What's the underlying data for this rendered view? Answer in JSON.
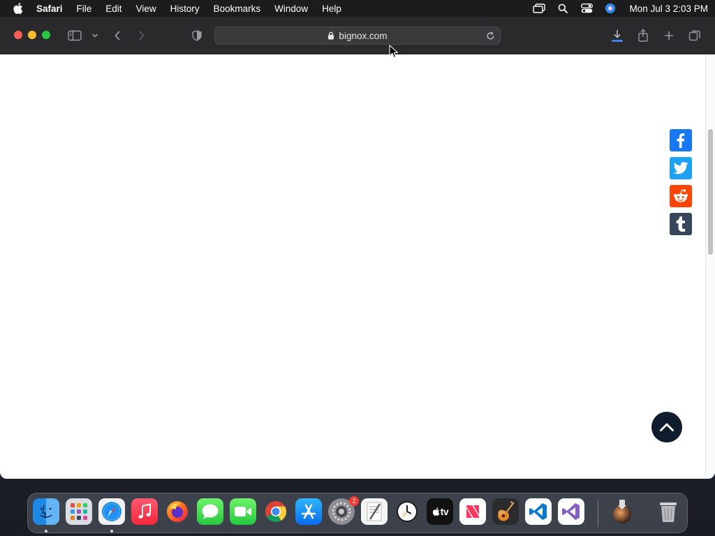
{
  "menubar": {
    "app_name": "Safari",
    "menus": [
      "File",
      "Edit",
      "View",
      "History",
      "Bookmarks",
      "Window",
      "Help"
    ],
    "clock": "Mon Jul 3  2:03 PM"
  },
  "toolbar": {
    "url": "bignox.com"
  },
  "page": {
    "share_buttons": [
      "facebook",
      "twitter",
      "reddit",
      "tumblr"
    ],
    "scroll_position": 0.12
  },
  "dock": {
    "apps": [
      "Finder",
      "Launchpad",
      "Safari",
      "Music",
      "Firefox",
      "Messages",
      "FaceTime",
      "Chrome",
      "App Store",
      "System Settings",
      "TextEdit",
      "Clock",
      "TV",
      "News",
      "GarageBand",
      "VS Code",
      "Visual Studio",
      "Downloads",
      "Trash"
    ],
    "tv_label": "tv",
    "settings_badge": "2"
  },
  "colors": {
    "facebook": "#1877f2",
    "twitter": "#1da1f2",
    "reddit": "#ff4500",
    "tumblr": "#36465d",
    "back_to_top": "#0f1c2e"
  }
}
